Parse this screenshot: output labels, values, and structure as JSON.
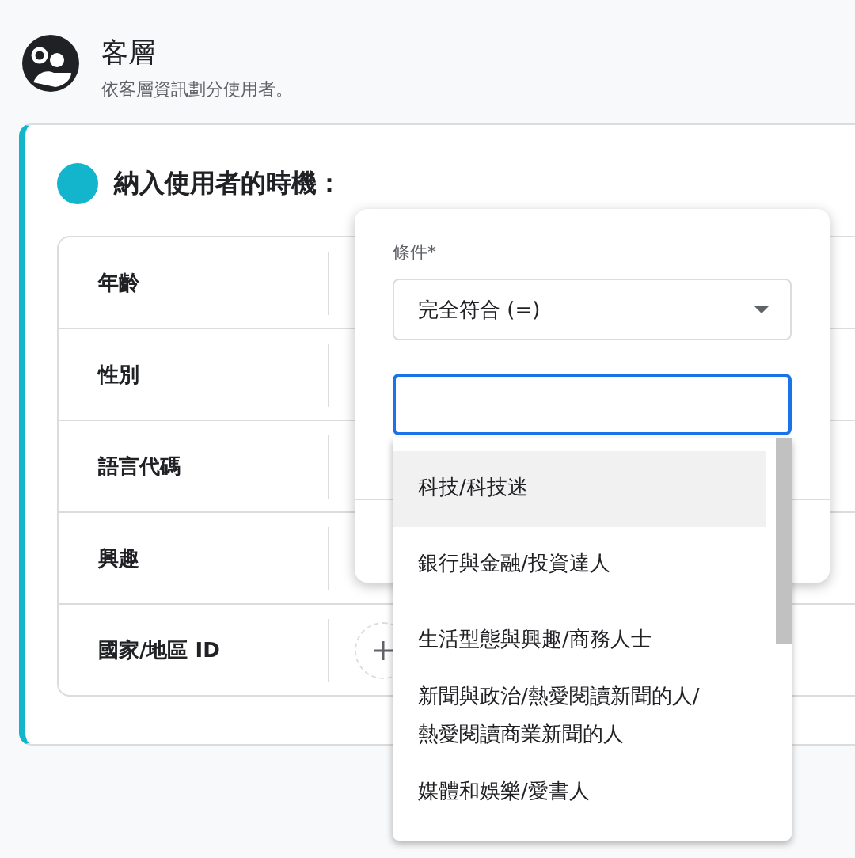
{
  "header": {
    "title": "客層",
    "subtitle": "依客層資訊劃分使用者。"
  },
  "card": {
    "heading": "納入使用者的時機：",
    "rows": [
      {
        "label": "年齡"
      },
      {
        "label": "性別"
      },
      {
        "label": "語言代碼"
      },
      {
        "label": "興趣"
      },
      {
        "label": "國家/地區 ID",
        "add_button": true
      }
    ]
  },
  "popup": {
    "condition_label": "條件*",
    "condition_value": "完全符合 (=)",
    "options": [
      {
        "label": "科技/科技迷",
        "selected": true
      },
      {
        "label": "銀行與金融/投資達人",
        "selected": false
      },
      {
        "label": "生活型態與興趣/商務人士",
        "selected": false
      },
      {
        "label": "新聞與政治/熱愛閱讀新聞的人/熱愛閱讀商業新聞的人",
        "selected": false
      },
      {
        "label": "媒體和娛樂/愛書人",
        "selected": false
      }
    ]
  }
}
